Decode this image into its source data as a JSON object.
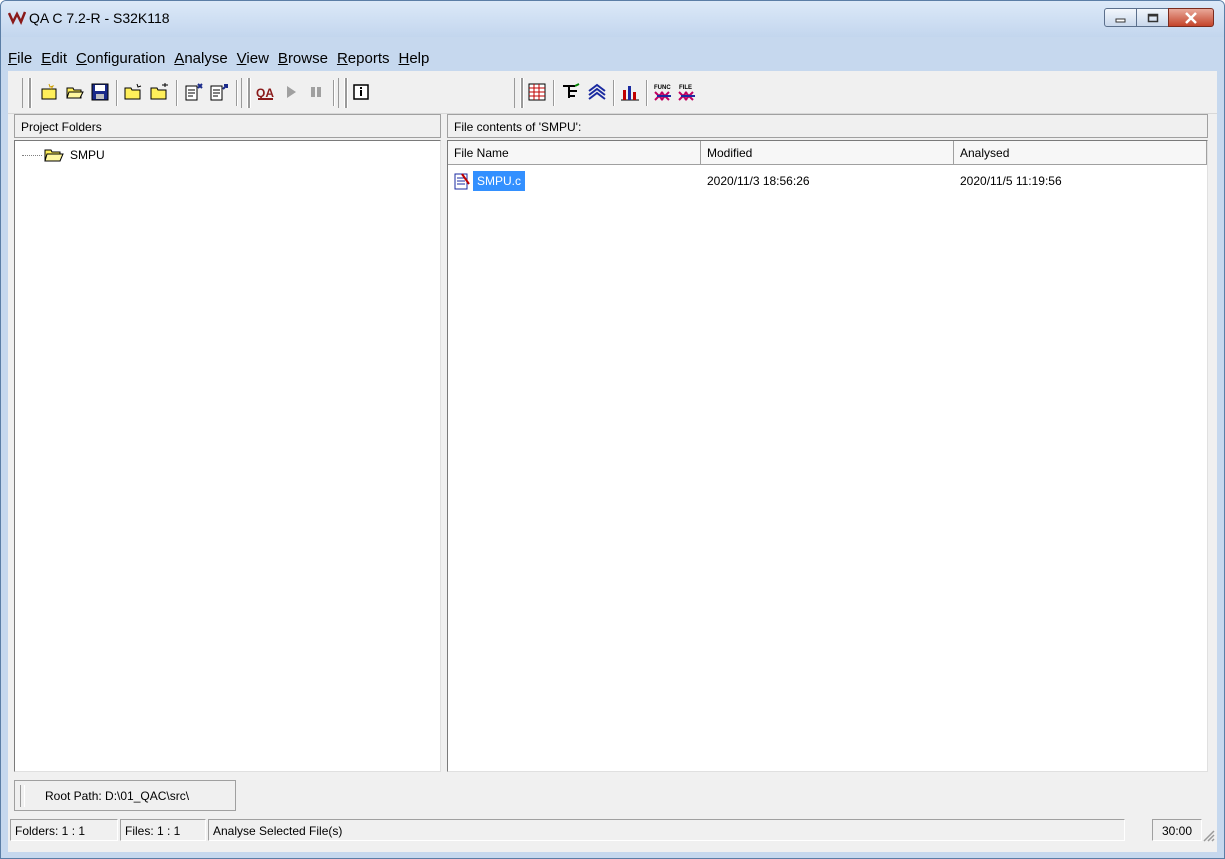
{
  "window": {
    "title": "QA C 7.2-R - S32K118",
    "colors": {
      "titlebar": "#c3d6ee",
      "selection": "#3390ff",
      "close_button": "#c4442a"
    }
  },
  "menubar": {
    "items": [
      {
        "label": "File",
        "mnemonic": "F"
      },
      {
        "label": "Edit",
        "mnemonic": "E"
      },
      {
        "label": "Configuration",
        "mnemonic": "C"
      },
      {
        "label": "Analyse",
        "mnemonic": "A"
      },
      {
        "label": "View",
        "mnemonic": "V"
      },
      {
        "label": "Browse",
        "mnemonic": "B"
      },
      {
        "label": "Reports",
        "mnemonic": "R"
      },
      {
        "label": "Help",
        "mnemonic": "H"
      }
    ]
  },
  "toolbar": {
    "icons": [
      "new-project-icon",
      "open-project-icon",
      "save-icon",
      "new-folder-icon",
      "open-folder-icon",
      "add-files-icon",
      "remove-files-icon",
      "qa-analyse-icon",
      "play-icon",
      "pause-icon",
      "info-icon",
      "metrics-table-icon",
      "call-tree-icon",
      "relations-icon",
      "bar-chart-icon",
      "func-graph-icon",
      "file-graph-icon"
    ]
  },
  "left_panel": {
    "header": "Project Folders",
    "folders": [
      {
        "label": "SMPU"
      }
    ]
  },
  "right_panel": {
    "header": "File contents of  'SMPU':",
    "columns": [
      "File Name",
      "Modified",
      "Analysed"
    ],
    "rows": [
      {
        "name": "SMPU.c",
        "modified": "2020/11/3 18:56:26",
        "analysed": "2020/11/5 11:19:56"
      }
    ]
  },
  "root_path": {
    "label": "Root Path:",
    "value": "D:\\01_QAC\\src\\"
  },
  "statusbar": {
    "folders": "Folders:  1 : 1",
    "files": "Files:  1 : 1",
    "message": "Analyse Selected File(s)",
    "time": "30:00"
  }
}
